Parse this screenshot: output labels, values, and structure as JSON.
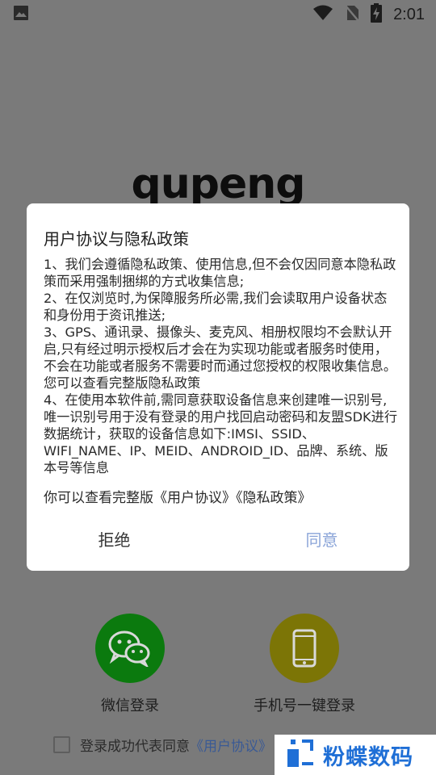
{
  "status_bar": {
    "time": "2:01",
    "icons": [
      "image-icon",
      "wifi-icon",
      "no-sim-icon",
      "battery-charging-icon"
    ]
  },
  "logo": {
    "text": "qupeng"
  },
  "dialog": {
    "title": "用户协议与隐私政策",
    "body": [
      "1、我们会遵循隐私政策、使用信息,但不会仅因同意本隐私政策而采用强制捆绑的方式收集信息;",
      "2、在仅浏览时,为保障服务所必需,我们会读取用户设备状态和身份用于资讯推送;",
      "3、GPS、通讯录、摄像头、麦克风、相册权限均不会默认开启,只有经过明示授权后才会在为实现功能或者服务时使用，不会在功能或者服务不需要时而通过您授权的权限收集信息。您可以查看完整版隐私政策",
      "4、在使用本软件前,需同意获取设备信息来创建唯一识别号,唯一识别号用于没有登录的用户找回启动密码和友盟SDK进行数据统计，获取的设备信息如下:IMSI、SSID、WIFI_NAME、IP、MEID、ANDROID_ID、品牌、系统、版本号等信息"
    ],
    "footer_text": "你可以查看完整版《用户协议》《隐私政策》",
    "reject_label": "拒绝",
    "agree_label": "同意"
  },
  "login": {
    "wechat_label": "微信登录",
    "phone_label": "手机号一键登录"
  },
  "agreement": {
    "text": "登录成功代表同意",
    "link": "《用户协议》"
  },
  "watermark": {
    "text": "粉蝶数码"
  },
  "colors": {
    "overlay_bg": "#7a7a7a",
    "wechat": "#0b7a0e",
    "phone": "#7c7506",
    "agree_button": "#8aa4d8",
    "watermark": "#1f6fd6"
  }
}
